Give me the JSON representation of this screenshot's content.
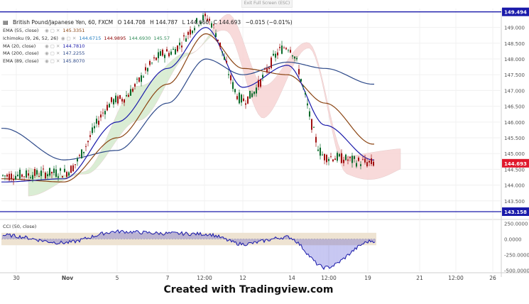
{
  "header": {
    "exit_fullscreen": "Exit Full Screen (ESC)",
    "symbol": "British Pound/Japanese Yen, 60, FXCM",
    "open": "O 144.708",
    "high": "H 144.787",
    "low": "L 144.660",
    "close": "C 144.693",
    "change": "−0.015 (−0.01%)"
  },
  "legend": [
    {
      "name": "EMA (55, close)",
      "values": [
        "145.3351"
      ],
      "colors": [
        "#8b4513"
      ]
    },
    {
      "name": "Ichimoku (9, 26, 52, 26)",
      "values": [
        "144.6715",
        "144.9895",
        "144.6930",
        "145.57"
      ],
      "colors": [
        "#1e7bbf",
        "#8b0000",
        "#2e8b57",
        "#2e8b57"
      ]
    },
    {
      "name": "MA (20, close)",
      "values": [
        "144.7810"
      ],
      "colors": [
        "#1a1aaa"
      ]
    },
    {
      "name": "MA (200, close)",
      "values": [
        "147.2255"
      ],
      "colors": [
        "#2e4a8a"
      ]
    },
    {
      "name": "EMA (89, close)",
      "values": [
        "145.8070"
      ],
      "colors": [
        "#2e4a8a"
      ]
    }
  ],
  "price_axis_labels": [
    "149.000",
    "148.500",
    "148.000",
    "147.500",
    "147.000",
    "146.500",
    "146.000",
    "145.500",
    "145.000",
    "144.500",
    "144.000",
    "143.500"
  ],
  "price_tags": {
    "upper_line": "149.494",
    "current": "144.693",
    "lower_line": "143.158"
  },
  "cci": {
    "label": "CCI (50, close)",
    "axis_labels": [
      "250.0000",
      "0.0000",
      "-250.0000",
      "-500.0000"
    ],
    "band": [
      -100,
      100
    ]
  },
  "time_axis_labels": [
    "30",
    "Nov",
    "5",
    "7",
    "12:00",
    "12",
    "14",
    "12:00",
    "19",
    "21",
    "12:00",
    "26"
  ],
  "footer": "Created with Tradingview.com",
  "colors": {
    "candle_up": "#0b6b2b",
    "candle_down": "#a01010",
    "ma20": "#1a1aaa",
    "ma200": "#2e4a8a",
    "ema55": "#8b4513",
    "cloud_bull": "#d6ecd0",
    "cloud_bear": "#f8d6d6",
    "hline": "#1a1aaa",
    "current_tag": "#e0182c"
  },
  "chart_data": {
    "type": "line",
    "ylim": [
      143.0,
      149.6
    ],
    "x": [
      "30",
      "Nov",
      "5",
      "7",
      "12:00",
      "12",
      "14",
      "12:00",
      "19"
    ],
    "series": [
      {
        "name": "British Pound/Japanese Yen",
        "values": [
          144.3,
          144.4,
          146.7,
          148.2,
          149.3,
          146.7,
          148.4,
          144.9,
          144.7
        ]
      },
      {
        "name": "MA (20, close)",
        "values": [
          144.1,
          144.2,
          146.0,
          147.7,
          149.0,
          147.1,
          147.8,
          145.9,
          144.8
        ]
      },
      {
        "name": "EMA (55, close)",
        "values": [
          144.2,
          144.1,
          145.5,
          147.2,
          148.8,
          147.7,
          147.5,
          146.6,
          145.3
        ]
      },
      {
        "name": "MA (200, close)",
        "values": [
          145.8,
          144.8,
          145.1,
          146.6,
          148.0,
          147.5,
          147.9,
          147.7,
          147.2
        ]
      }
    ],
    "cci_values": [
      60,
      -60,
      120,
      90,
      80,
      -80,
      30,
      -460,
      -30
    ],
    "hlines": [
      149.494,
      143.158
    ]
  }
}
